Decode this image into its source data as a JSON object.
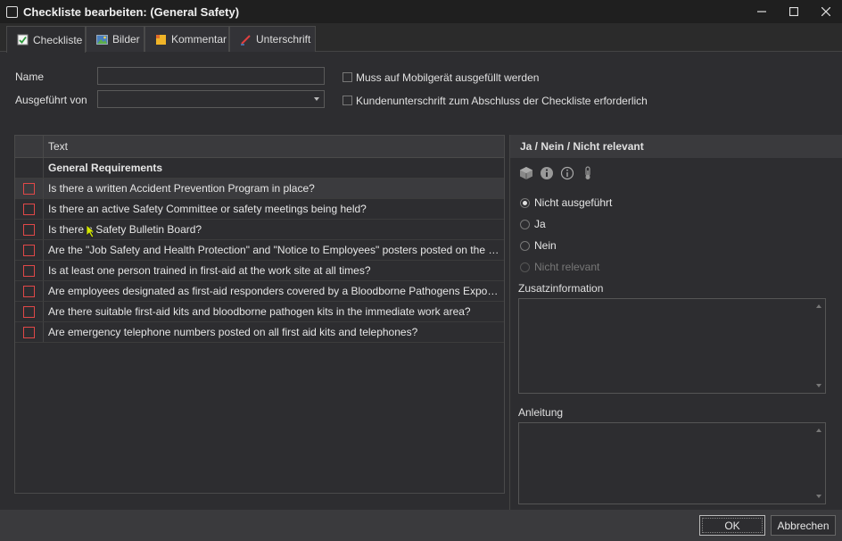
{
  "window": {
    "title": "Checkliste bearbeiten: (General Safety)",
    "minimize_icon": "minimize-icon",
    "maximize_icon": "maximize-icon",
    "close_icon": "close-icon"
  },
  "tabs": [
    {
      "label": "Checkliste",
      "icon": "checklist-icon",
      "active": true
    },
    {
      "label": "Bilder",
      "icon": "image-icon",
      "active": false
    },
    {
      "label": "Kommentar",
      "icon": "comment-icon",
      "active": false
    },
    {
      "label": "Unterschrift",
      "icon": "signature-icon",
      "active": false
    }
  ],
  "form": {
    "name_label": "Name",
    "name_value": "",
    "executed_by_label": "Ausgeführt von",
    "executed_by_value": "",
    "mobile_required_label": "Muss auf Mobilgerät ausgefüllt werden",
    "mobile_required_checked": false,
    "customer_signature_label": "Kundenunterschrift zum Abschluss der Checkliste erforderlich",
    "customer_signature_checked": false
  },
  "grid": {
    "column_header": "Text",
    "group": "General Requirements",
    "rows": [
      "Is there a written Accident Prevention Program in place?",
      "Is there an active Safety Committee or safety meetings being held?",
      "Is there a Safety Bulletin Board?",
      "Are the \"Job Safety and Health Protection\" and \"Notice to Employees\" posters posted on the Safety Bulletin Board?",
      "Is at least one person trained in first-aid at the work site at all times?",
      "Are employees designated as first-aid responders covered by a Bloodborne Pathogens Exposure Control Plan?",
      "Are there suitable first-aid kits and bloodborne pathogen kits in the immediate work area?",
      "Are emergency telephone numbers posted on all first aid kits and telephones?"
    ],
    "selected_row": 0
  },
  "right_panel": {
    "header": "Ja / Nein / Nicht relevant",
    "toolbar_icons": [
      "cube-icon",
      "info-filled-icon",
      "info-outline-icon",
      "thermometer-icon"
    ],
    "options": [
      {
        "label": "Nicht ausgeführt",
        "selected": true,
        "enabled": true
      },
      {
        "label": "Ja",
        "selected": false,
        "enabled": true
      },
      {
        "label": "Nein",
        "selected": false,
        "enabled": true
      },
      {
        "label": "Nicht relevant",
        "selected": false,
        "enabled": false
      }
    ],
    "additional_info_label": "Zusatzinformation",
    "additional_info_value": "",
    "instructions_label": "Anleitung",
    "instructions_value": ""
  },
  "buttons": {
    "ok": "OK",
    "cancel": "Abbrechen"
  },
  "colors": {
    "background": "#2d2d30",
    "titlebar": "#1f1f1f",
    "checkbox_red": "#e04848"
  }
}
